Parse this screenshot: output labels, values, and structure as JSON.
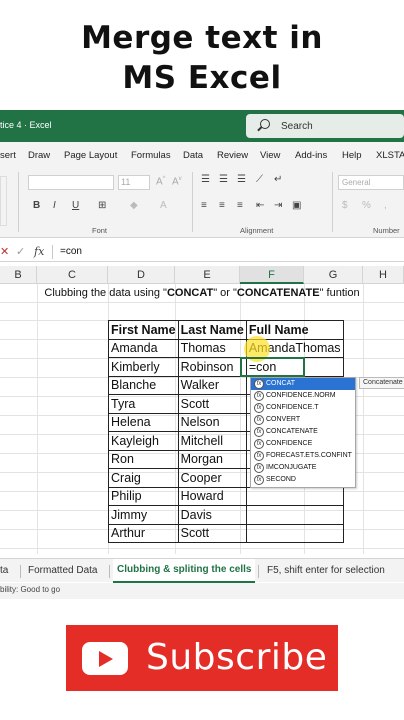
{
  "headline": {
    "line1": "Merge text in",
    "line2": "MS Excel"
  },
  "titlebar": {
    "doc_label": "tice 4  ·  Excel",
    "search_placeholder": "Search"
  },
  "menu": [
    "sert",
    "Draw",
    "Page Layout",
    "Formulas",
    "Data",
    "Review",
    "View",
    "Add-ins",
    "Help",
    "XLSTAT"
  ],
  "ribbon": {
    "font_size": "11",
    "number_format": "General",
    "bold": "B",
    "italic": "I",
    "underline": "U",
    "groups": {
      "font": "Font",
      "alignment": "Alignment",
      "number": "Number"
    }
  },
  "formula_bar": {
    "cancel": "✕",
    "enter": "✓",
    "fx": "fx",
    "formula": "=con"
  },
  "columns": [
    "B",
    "C",
    "D",
    "E",
    "F",
    "G",
    "H"
  ],
  "active_column": "F",
  "sheet_title": {
    "before": "Clubbing the data using \"",
    "func1": "CONCAT",
    "middle": "\" or \"",
    "func2": "CONCATENATE",
    "after": "\" funtion"
  },
  "table": {
    "headers": [
      "First Name",
      "Last Name",
      "Full Name"
    ],
    "rows": [
      [
        "Amanda",
        "Thomas",
        "AmandaThomas"
      ],
      [
        "Kimberly",
        "Robinson",
        "=con"
      ],
      [
        "Blanche",
        "Walker",
        ""
      ],
      [
        "Tyra",
        "Scott",
        ""
      ],
      [
        "Helena",
        "Nelson",
        ""
      ],
      [
        "Kayleigh",
        "Mitchell",
        ""
      ],
      [
        "Ron",
        "Morgan",
        ""
      ],
      [
        "Craig",
        "Cooper",
        ""
      ],
      [
        "Philip",
        "Howard",
        ""
      ],
      [
        "Jimmy",
        "Davis",
        ""
      ],
      [
        "Arthur",
        "Scott",
        ""
      ]
    ]
  },
  "autocomplete": {
    "items": [
      "CONCAT",
      "CONFIDENCE.NORM",
      "CONFIDENCE.T",
      "CONVERT",
      "CONCATENATE",
      "CONFIDENCE",
      "FORECAST.ETS.CONFINT",
      "IMCONJUGATE",
      "SECOND"
    ],
    "selected_index": 0,
    "tooltip": "Concatenate"
  },
  "sheet_tabs": {
    "t0": "ta",
    "t1": "Formatted Data",
    "t2": "Clubbing & spliting the cells",
    "t3": "F5, shift enter for selection"
  },
  "status": "bility: Good to go",
  "subscribe": {
    "label": "Subscribe"
  },
  "colors": {
    "excel_green": "#217346",
    "subscribe_red": "#e52d27",
    "selection_blue": "#2b73d2"
  }
}
